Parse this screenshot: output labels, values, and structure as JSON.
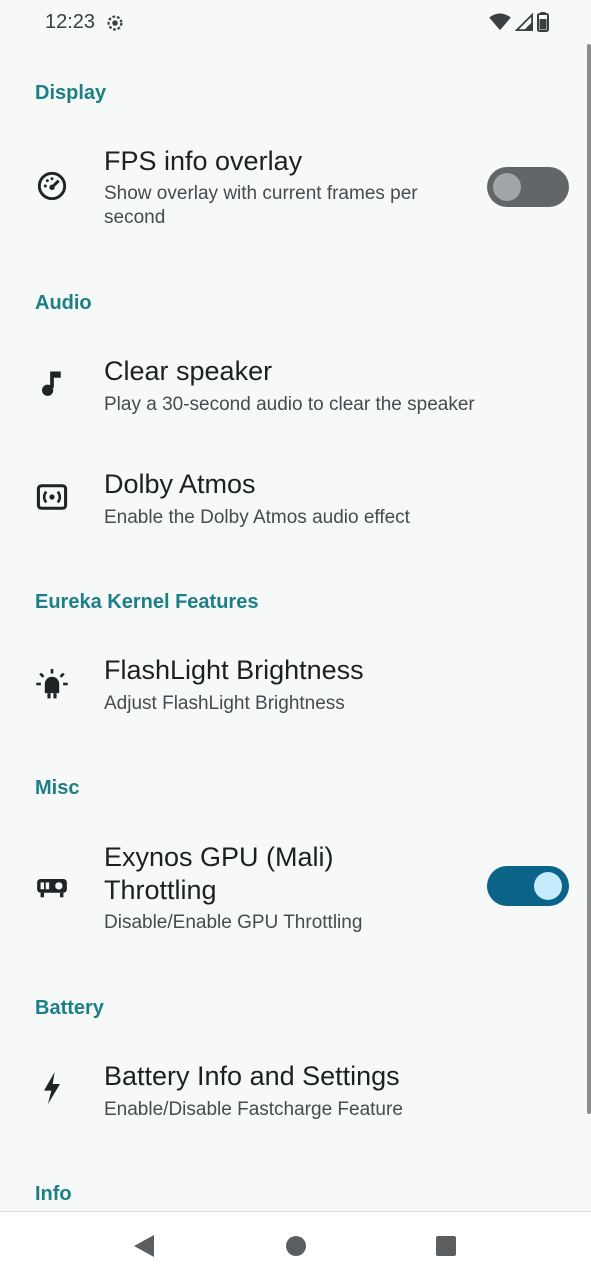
{
  "status_bar": {
    "time": "12:23"
  },
  "sections": {
    "display": "Display",
    "audio": "Audio",
    "eureka": "Eureka Kernel Features",
    "misc": "Misc",
    "battery": "Battery",
    "info": "Info"
  },
  "prefs": {
    "fps": {
      "title": "FPS info overlay",
      "summary_line1": "Show overlay with current frames per",
      "summary_line2": "second",
      "icon": "speedometer-icon",
      "toggle_on": false
    },
    "clear_speaker": {
      "title": "Clear speaker",
      "summary": "Play a 30-second audio to clear the speaker",
      "icon": "music-note-icon"
    },
    "dolby": {
      "title": "Dolby Atmos",
      "summary": "Enable the Dolby Atmos audio effect",
      "icon": "speaker-icon"
    },
    "flashlight": {
      "title": "FlashLight Brightness",
      "summary": "Adjust FlashLight Brightness",
      "icon": "light-icon"
    },
    "gpu": {
      "title_line1": "Exynos GPU (Mali)",
      "title_line2": "Throttling",
      "summary": "Disable/Enable GPU Throttling",
      "icon": "gpu-icon",
      "toggle_on": true
    },
    "battery": {
      "title": "Battery Info and Settings",
      "summary": "Enable/Disable Fastcharge Feature",
      "icon": "bolt-icon"
    }
  },
  "colors": {
    "accent": "#1d7f86",
    "toggle_on_track": "#0b6388",
    "toggle_off_track": "#626669",
    "background": "#f7f9f9"
  }
}
